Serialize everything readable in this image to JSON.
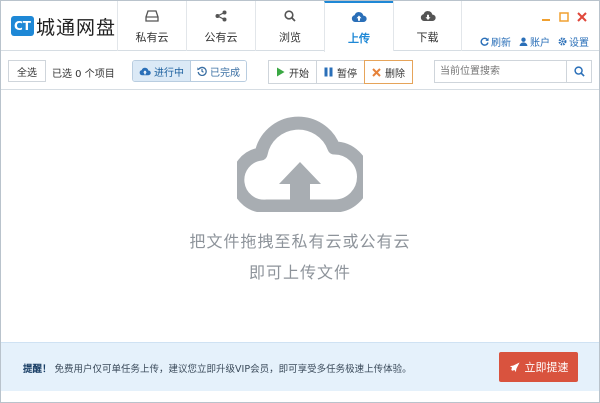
{
  "app": {
    "logo_badge": "CT",
    "logo_text": "城通网盘"
  },
  "nav": {
    "tabs": [
      {
        "label": "私有云",
        "icon": "drive-icon"
      },
      {
        "label": "公有云",
        "icon": "share-icon"
      },
      {
        "label": "浏览",
        "icon": "search-icon"
      },
      {
        "label": "上传",
        "icon": "cloud-upload-icon",
        "active": true
      },
      {
        "label": "下载",
        "icon": "cloud-download-icon"
      }
    ]
  },
  "top_links": {
    "refresh": "刷新",
    "account": "账户",
    "settings": "设置"
  },
  "toolbar": {
    "select_all": "全选",
    "selected_count": "已选 0 个项目",
    "filter_in_progress": "进行中",
    "filter_completed": "已完成",
    "start": "开始",
    "pause": "暂停",
    "delete": "删除",
    "search_placeholder": "当前位置搜索"
  },
  "main": {
    "empty_line1": "把文件拖拽至私有云或公有云",
    "empty_line2": "即可上传文件"
  },
  "banner": {
    "prefix": "提醒！",
    "text": "免费用户仅可单任务上传，建议您立即升级VIP会员，即可享受多任务极速上传体验。",
    "button": "立即提速"
  },
  "colors": {
    "accent": "#1e88d6",
    "start_green": "#3aa843",
    "pause_blue": "#2a6fb8",
    "delete_orange": "#e6823a",
    "boost_red": "#d9533e",
    "win_min": "#f0a030",
    "win_close": "#e0473a"
  }
}
